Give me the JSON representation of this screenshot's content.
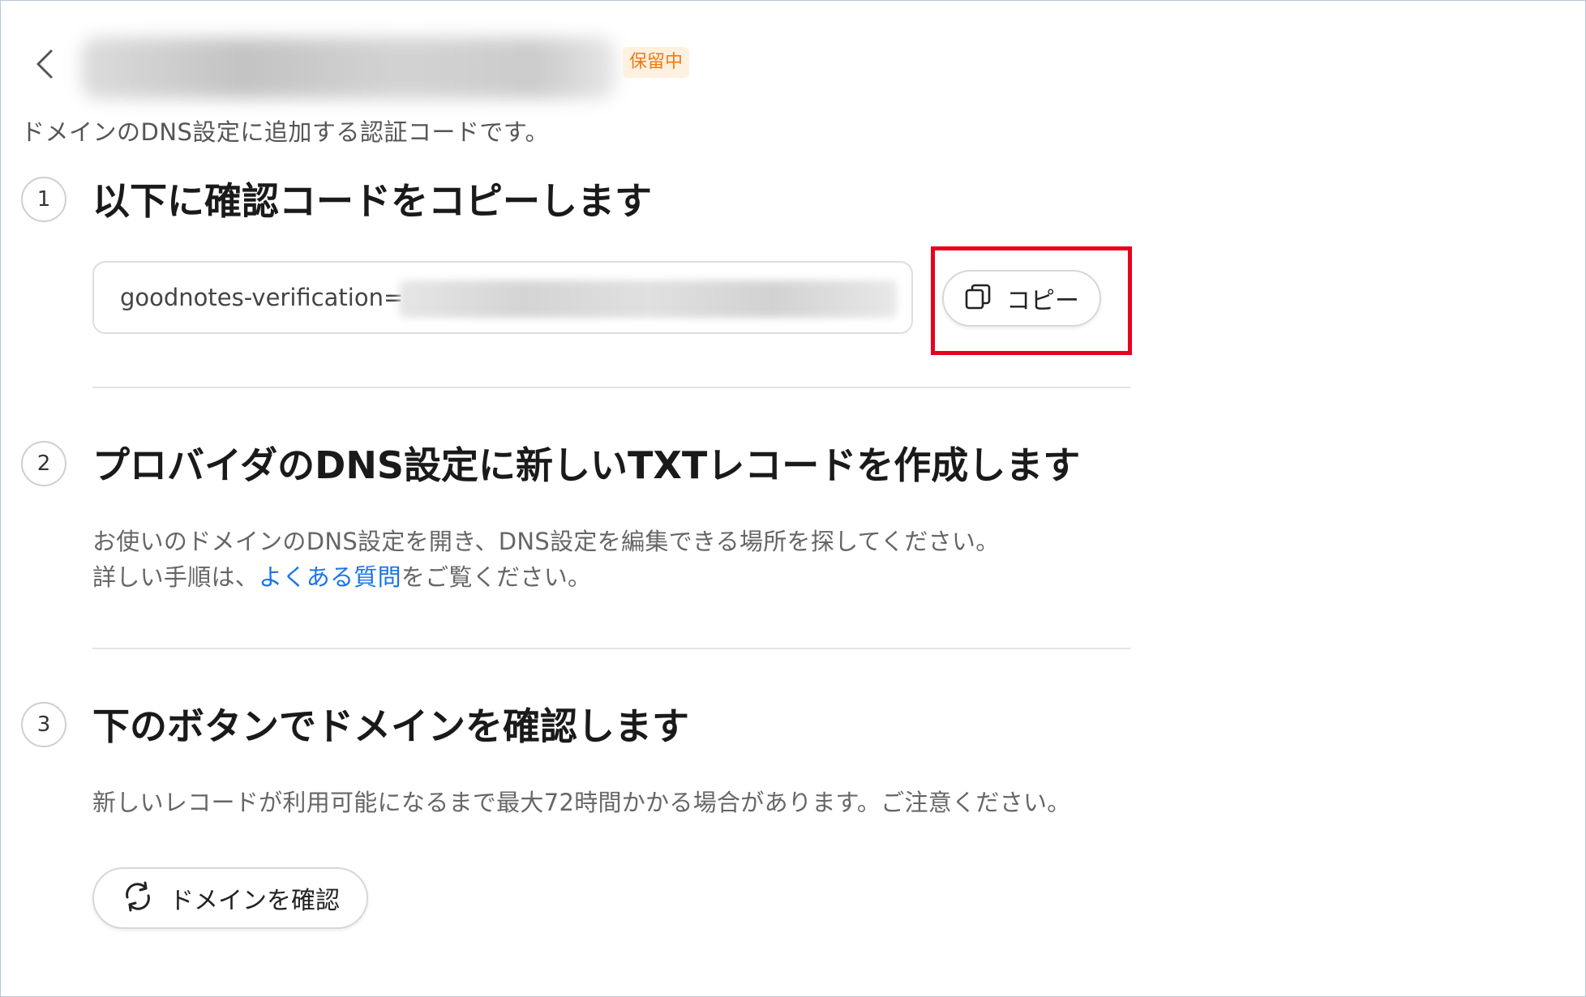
{
  "header": {
    "back_icon": "chevron-left-icon",
    "status_badge": "保留中",
    "subtitle": "ドメインのDNS設定に追加する認証コードです。"
  },
  "steps": [
    {
      "number": "1",
      "title": "以下に確認コードをコピーします",
      "code_prefix": "goodnotes-verification=",
      "copy_icon": "copy-icon",
      "copy_label": "コピー"
    },
    {
      "number": "2",
      "title": "プロバイダのDNS設定に新しいTXTレコードを作成します",
      "desc_line1": "お使いのドメインのDNS設定を開き、DNS設定を編集できる場所を探してください。",
      "desc_line2_before": "詳しい手順は、",
      "desc_link": "よくある質問",
      "desc_line2_after": "をご覧ください。"
    },
    {
      "number": "3",
      "title": "下のボタンでドメインを確認します",
      "desc": "新しいレコードが利用可能になるまで最大72時間かかる場合があります。ご注意ください。",
      "verify_icon": "refresh-icon",
      "verify_label": "ドメインを確認"
    }
  ],
  "colors": {
    "badge_text": "#ea7c1a",
    "badge_bg": "#fff1df",
    "link": "#1a73e8",
    "highlight": "#e8001c"
  }
}
